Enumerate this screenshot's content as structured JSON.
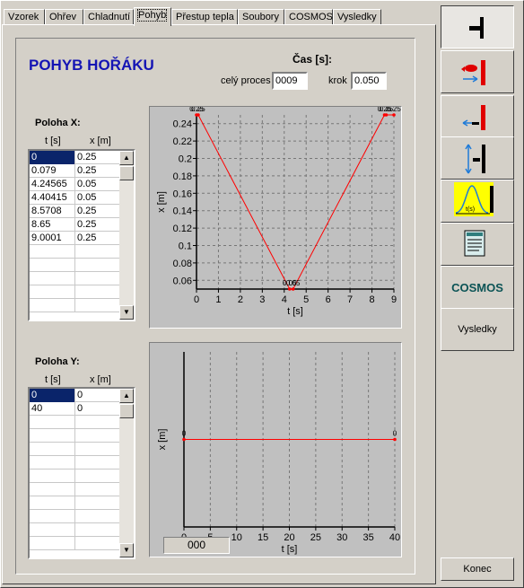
{
  "tabs": [
    "Vzorek",
    "Ohřev",
    "Chladnutí",
    "Pohyb",
    "Přestup tepla",
    "Soubory",
    "COSMOS",
    "Vysledky"
  ],
  "active_tab": "Pohyb",
  "page_title": "POHYB HOŘÁKU",
  "cas": {
    "label": "Čas [s]:",
    "cely_proces_label": "celý proces",
    "cely_proces_value": "0009",
    "krok_label": "krok",
    "krok_value": "0.050"
  },
  "poloha_x": {
    "title": "Poloha X:",
    "col_t": "t [s]",
    "col_x": "x [m]",
    "rows": [
      [
        "0",
        "0.25"
      ],
      [
        "0.079",
        "0.25"
      ],
      [
        "4.24565",
        "0.05"
      ],
      [
        "4.40415",
        "0.05"
      ],
      [
        "8.5708",
        "0.25"
      ],
      [
        "8.65",
        "0.25"
      ],
      [
        "9.0001",
        "0.25"
      ]
    ],
    "empty_rows": 5
  },
  "poloha_y": {
    "title": "Poloha Y:",
    "col_t": "t [s]",
    "col_x": "x [m]",
    "rows": [
      [
        "0",
        "0"
      ],
      [
        "40",
        "0"
      ]
    ],
    "empty_rows": 10
  },
  "status_value": "000",
  "toolbar": {
    "cosmos_label": "COSMOS",
    "vysledky_label": "Vysledky",
    "konec_label": "Konec",
    "highlight_color": "#ffff00",
    "accent_red": "#e00000",
    "accent_blue": "#1f7bd8"
  },
  "chart_data": [
    {
      "type": "line",
      "title": "",
      "xlabel": "t [s]",
      "ylabel": "x [m]",
      "xlim": [
        0,
        9
      ],
      "ylim": [
        0.05,
        0.25
      ],
      "xticks": [
        "0",
        "1",
        "2",
        "3",
        "4",
        "5",
        "6",
        "7",
        "8",
        "9"
      ],
      "yticks": [
        "0.06",
        "0.08",
        "0.1",
        "0.12",
        "0.14",
        "0.16",
        "0.18",
        "0.2",
        "0.22",
        "0.24"
      ],
      "x": [
        0,
        0.079,
        4.24565,
        4.40415,
        8.5708,
        8.65,
        9.0001
      ],
      "y": [
        0.25,
        0.25,
        0.05,
        0.05,
        0.25,
        0.25,
        0.25
      ],
      "point_labels": [
        "0.25",
        "0.25",
        "0.05",
        "0.05",
        "0.25",
        "0.25",
        "0.25"
      ],
      "color": "#ff0000",
      "grid": true
    },
    {
      "type": "line",
      "title": "",
      "xlabel": "t [s]",
      "ylabel": "x [m]",
      "xlim": [
        0,
        40
      ],
      "ylim": [
        -1,
        1
      ],
      "xticks": [
        "0",
        "5",
        "10",
        "15",
        "20",
        "25",
        "30",
        "35",
        "40"
      ],
      "yticks": [],
      "x": [
        0,
        40
      ],
      "y": [
        0,
        0
      ],
      "point_labels": [
        "0",
        "0"
      ],
      "color": "#ff0000",
      "grid": true
    }
  ]
}
